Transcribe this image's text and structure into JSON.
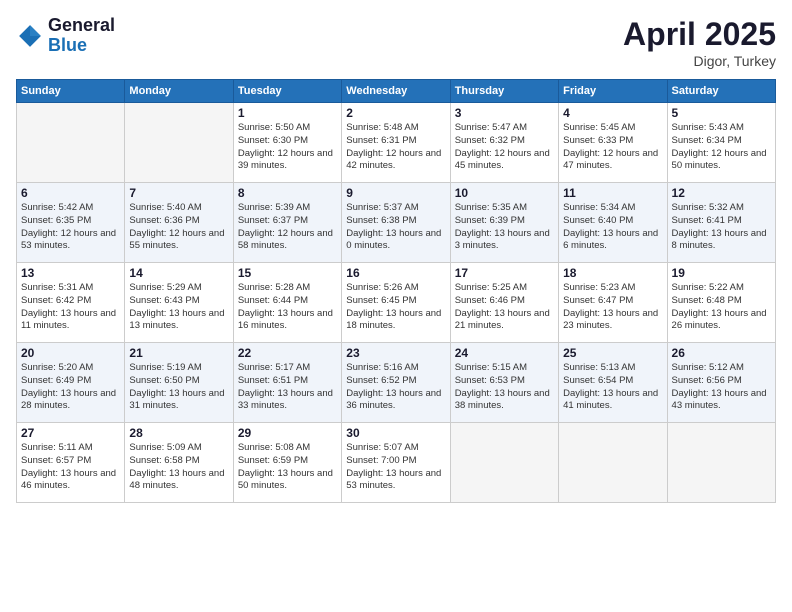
{
  "header": {
    "logo_general": "General",
    "logo_blue": "Blue",
    "month_title": "April 2025",
    "location": "Digor, Turkey"
  },
  "days_of_week": [
    "Sunday",
    "Monday",
    "Tuesday",
    "Wednesday",
    "Thursday",
    "Friday",
    "Saturday"
  ],
  "weeks": [
    [
      {
        "day": "",
        "empty": true
      },
      {
        "day": "",
        "empty": true
      },
      {
        "day": "1",
        "sunrise": "5:50 AM",
        "sunset": "6:30 PM",
        "daylight": "12 hours and 39 minutes."
      },
      {
        "day": "2",
        "sunrise": "5:48 AM",
        "sunset": "6:31 PM",
        "daylight": "12 hours and 42 minutes."
      },
      {
        "day": "3",
        "sunrise": "5:47 AM",
        "sunset": "6:32 PM",
        "daylight": "12 hours and 45 minutes."
      },
      {
        "day": "4",
        "sunrise": "5:45 AM",
        "sunset": "6:33 PM",
        "daylight": "12 hours and 47 minutes."
      },
      {
        "day": "5",
        "sunrise": "5:43 AM",
        "sunset": "6:34 PM",
        "daylight": "12 hours and 50 minutes."
      }
    ],
    [
      {
        "day": "6",
        "sunrise": "5:42 AM",
        "sunset": "6:35 PM",
        "daylight": "12 hours and 53 minutes."
      },
      {
        "day": "7",
        "sunrise": "5:40 AM",
        "sunset": "6:36 PM",
        "daylight": "12 hours and 55 minutes."
      },
      {
        "day": "8",
        "sunrise": "5:39 AM",
        "sunset": "6:37 PM",
        "daylight": "12 hours and 58 minutes."
      },
      {
        "day": "9",
        "sunrise": "5:37 AM",
        "sunset": "6:38 PM",
        "daylight": "13 hours and 0 minutes."
      },
      {
        "day": "10",
        "sunrise": "5:35 AM",
        "sunset": "6:39 PM",
        "daylight": "13 hours and 3 minutes."
      },
      {
        "day": "11",
        "sunrise": "5:34 AM",
        "sunset": "6:40 PM",
        "daylight": "13 hours and 6 minutes."
      },
      {
        "day": "12",
        "sunrise": "5:32 AM",
        "sunset": "6:41 PM",
        "daylight": "13 hours and 8 minutes."
      }
    ],
    [
      {
        "day": "13",
        "sunrise": "5:31 AM",
        "sunset": "6:42 PM",
        "daylight": "13 hours and 11 minutes."
      },
      {
        "day": "14",
        "sunrise": "5:29 AM",
        "sunset": "6:43 PM",
        "daylight": "13 hours and 13 minutes."
      },
      {
        "day": "15",
        "sunrise": "5:28 AM",
        "sunset": "6:44 PM",
        "daylight": "13 hours and 16 minutes."
      },
      {
        "day": "16",
        "sunrise": "5:26 AM",
        "sunset": "6:45 PM",
        "daylight": "13 hours and 18 minutes."
      },
      {
        "day": "17",
        "sunrise": "5:25 AM",
        "sunset": "6:46 PM",
        "daylight": "13 hours and 21 minutes."
      },
      {
        "day": "18",
        "sunrise": "5:23 AM",
        "sunset": "6:47 PM",
        "daylight": "13 hours and 23 minutes."
      },
      {
        "day": "19",
        "sunrise": "5:22 AM",
        "sunset": "6:48 PM",
        "daylight": "13 hours and 26 minutes."
      }
    ],
    [
      {
        "day": "20",
        "sunrise": "5:20 AM",
        "sunset": "6:49 PM",
        "daylight": "13 hours and 28 minutes."
      },
      {
        "day": "21",
        "sunrise": "5:19 AM",
        "sunset": "6:50 PM",
        "daylight": "13 hours and 31 minutes."
      },
      {
        "day": "22",
        "sunrise": "5:17 AM",
        "sunset": "6:51 PM",
        "daylight": "13 hours and 33 minutes."
      },
      {
        "day": "23",
        "sunrise": "5:16 AM",
        "sunset": "6:52 PM",
        "daylight": "13 hours and 36 minutes."
      },
      {
        "day": "24",
        "sunrise": "5:15 AM",
        "sunset": "6:53 PM",
        "daylight": "13 hours and 38 minutes."
      },
      {
        "day": "25",
        "sunrise": "5:13 AM",
        "sunset": "6:54 PM",
        "daylight": "13 hours and 41 minutes."
      },
      {
        "day": "26",
        "sunrise": "5:12 AM",
        "sunset": "6:56 PM",
        "daylight": "13 hours and 43 minutes."
      }
    ],
    [
      {
        "day": "27",
        "sunrise": "5:11 AM",
        "sunset": "6:57 PM",
        "daylight": "13 hours and 46 minutes."
      },
      {
        "day": "28",
        "sunrise": "5:09 AM",
        "sunset": "6:58 PM",
        "daylight": "13 hours and 48 minutes."
      },
      {
        "day": "29",
        "sunrise": "5:08 AM",
        "sunset": "6:59 PM",
        "daylight": "13 hours and 50 minutes."
      },
      {
        "day": "30",
        "sunrise": "5:07 AM",
        "sunset": "7:00 PM",
        "daylight": "13 hours and 53 minutes."
      },
      {
        "day": "",
        "empty": true
      },
      {
        "day": "",
        "empty": true
      },
      {
        "day": "",
        "empty": true
      }
    ]
  ]
}
